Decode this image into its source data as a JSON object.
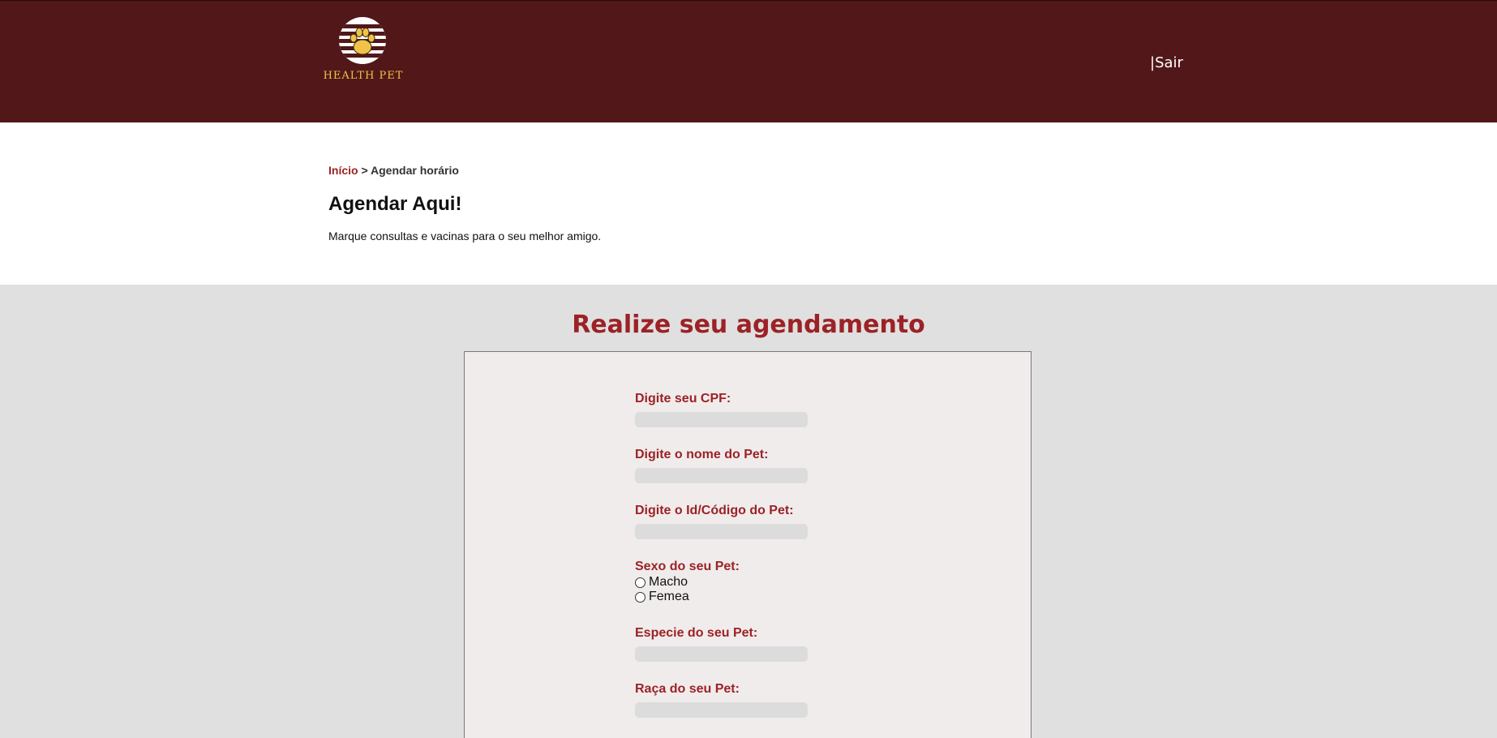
{
  "header": {
    "logo_text": "HEALTH PET",
    "logout_label": "|Sair",
    "background": "#511719",
    "logo_text_color": "#f0c24a"
  },
  "breadcrumb": {
    "home": "Início",
    "separator": ">",
    "current": "Agendar horário"
  },
  "intro": {
    "title": "Agendar Aqui!",
    "subtitle": "Marque consultas e vacinas para o seu melhor amigo."
  },
  "form": {
    "title": "Realize seu agendamento",
    "cpf_label": "Digite seu CPF:",
    "pet_name_label": "Digite o nome do Pet:",
    "pet_id_label": "Digite o Id/Código do Pet:",
    "sex_label": "Sexo do seu Pet:",
    "sex_options": [
      "Macho",
      "Femea"
    ],
    "species_label": "Especie do seu Pet:",
    "breed_label": "Raça do seu Pet:"
  },
  "colors": {
    "accent": "#9c2226",
    "page_background": "#e0e0e0",
    "form_background": "#f0ecec",
    "input_background": "#dcdcdc"
  },
  "icons": {
    "logo": "paw-icon",
    "radio": "radio-unchecked-icon"
  }
}
